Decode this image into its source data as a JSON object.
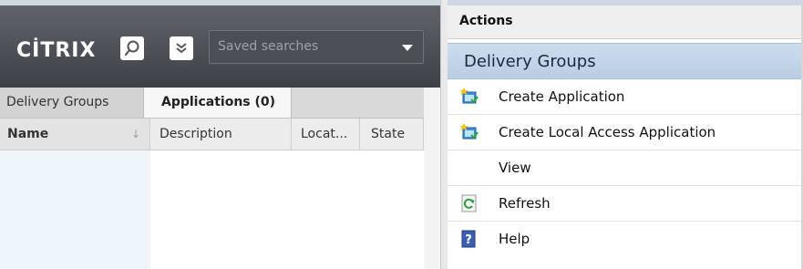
{
  "left": {
    "logo": "CİTRIX",
    "search": {
      "placeholder": "Saved searches"
    },
    "tabs": [
      {
        "label": "Delivery Groups"
      },
      {
        "label": "Applications (0)"
      }
    ],
    "columns": [
      {
        "label": "Name"
      },
      {
        "label": "Description"
      },
      {
        "label": "Locat..."
      },
      {
        "label": "State"
      }
    ]
  },
  "actions": {
    "title": "Actions",
    "group": "Delivery Groups",
    "items": [
      {
        "label": "Create Application",
        "icon": "create-application-icon"
      },
      {
        "label": "Create Local Access Application",
        "icon": "create-local-access-application-icon"
      },
      {
        "label": "View",
        "icon": ""
      },
      {
        "label": "Refresh",
        "icon": "refresh-icon"
      },
      {
        "label": "Help",
        "icon": "help-icon"
      }
    ]
  },
  "colors": {
    "brand_bar": "#4a4e54",
    "group_header": "#c3d5e8",
    "name_column": "#eef5fb"
  }
}
